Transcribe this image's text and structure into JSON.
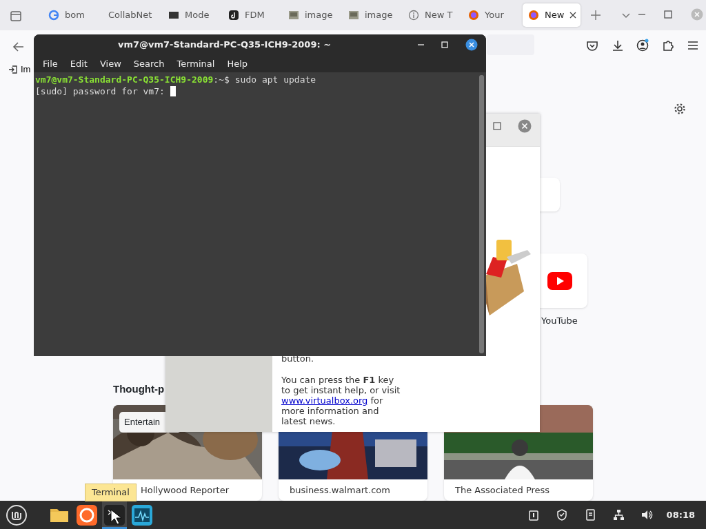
{
  "browser": {
    "tabs": [
      {
        "label": "bom",
        "selected": false
      },
      {
        "label": "CollabNet",
        "selected": false
      },
      {
        "label": "Mode",
        "selected": false
      },
      {
        "label": "FDM",
        "selected": false
      },
      {
        "label": "image",
        "selected": false
      },
      {
        "label": "image",
        "selected": false
      },
      {
        "label": "New T",
        "selected": false
      },
      {
        "label": "Your",
        "selected": false
      },
      {
        "label": "New",
        "selected": true
      }
    ],
    "bookmark": "Im",
    "shortcuts": [
      {
        "label": "YouTube"
      }
    ],
    "section_heading": "Thought-p",
    "cards": [
      {
        "tag": "Entertain",
        "source": "Hollywood Reporter"
      },
      {
        "source": "business.walmart.com"
      },
      {
        "source": "The Associated Press"
      }
    ]
  },
  "dialog": {
    "text_fragment": "button.",
    "help_text_before": "You can press the **F1** key to get instant help, or visit",
    "link": "www.virtualbox.org",
    "help_text_after": "for more information and latest news."
  },
  "terminal": {
    "title": "vm7@vm7-Standard-PC-Q35-ICH9-2009: ~",
    "menu": [
      "File",
      "Edit",
      "View",
      "Search",
      "Terminal",
      "Help"
    ],
    "prompt_user": "vm7@vm7-Standard-PC-Q35-ICH9-2009",
    "prompt_path": ":~$",
    "command": "sudo apt update",
    "output": "[sudo] password for vm7:"
  },
  "taskbar": {
    "apps": [
      {
        "active": false
      },
      {
        "active": false
      },
      {
        "active": true
      },
      {
        "active": false
      }
    ],
    "clock": "08:18",
    "tooltip": "Terminal"
  }
}
